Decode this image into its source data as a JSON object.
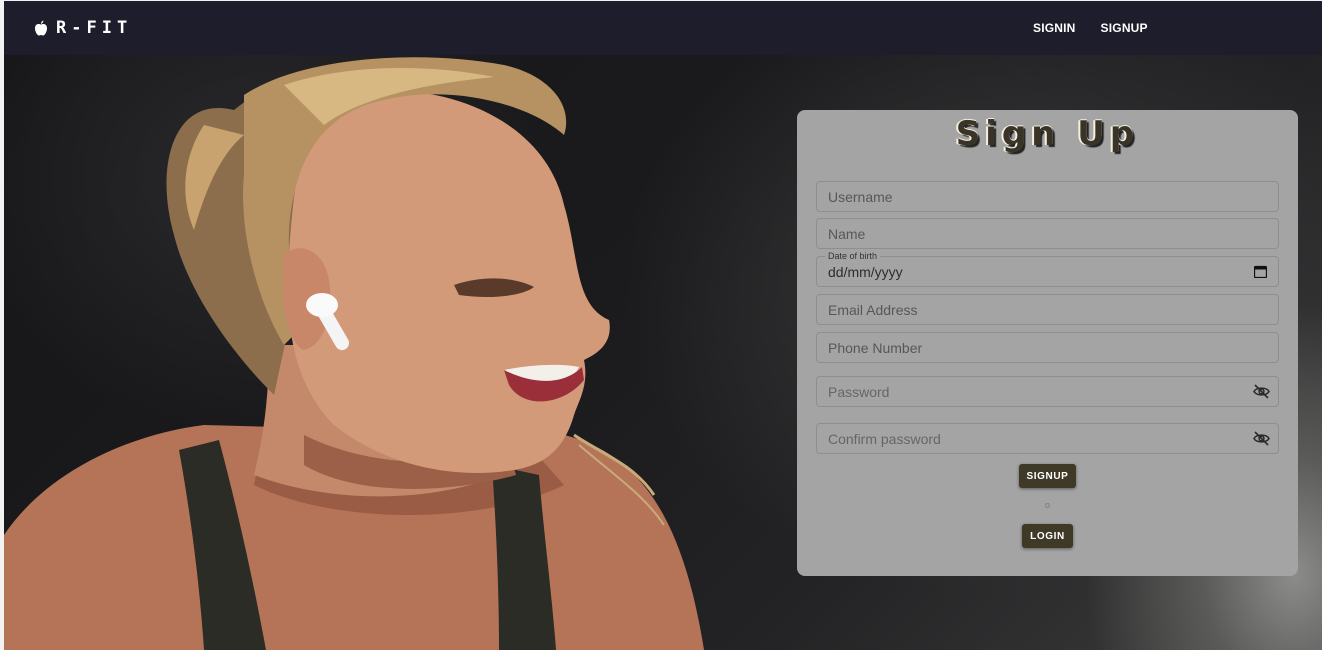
{
  "brand": {
    "name": "R-FIT",
    "icon": "apple-icon"
  },
  "nav": {
    "signin_label": "SIGNIN",
    "signup_label": "SIGNUP"
  },
  "form": {
    "title": "Sign Up",
    "username_placeholder": "Username",
    "name_placeholder": "Name",
    "dob_label": "Date of birth",
    "dob_value": "dd/mm/yyyy",
    "email_placeholder": "Email Address",
    "phone_placeholder": "Phone Number",
    "password_placeholder": "Password",
    "confirm_password_placeholder": "Confirm password",
    "signup_button": "SIGNUP",
    "or_text": "o",
    "login_button": "LOGIN"
  },
  "icons": {
    "calendar": "calendar-icon",
    "visibility": "eye-off-icon"
  },
  "colors": {
    "navbar": "#1e1d2b",
    "card": "#a4a4a4",
    "button": "#3f3928",
    "title": "#3a3428"
  }
}
